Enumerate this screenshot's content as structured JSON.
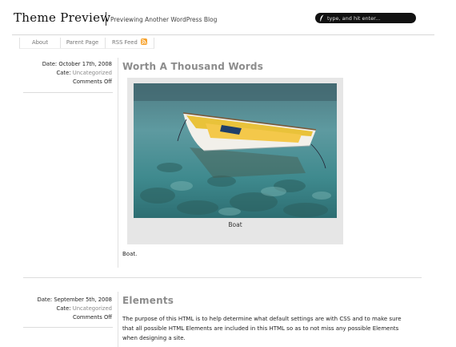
{
  "site": {
    "title": "Theme Preview",
    "tagline": "Previewing Another WordPress Blog",
    "search_placeholder": "type, and hit enter..."
  },
  "nav": {
    "items": [
      {
        "label": "About"
      },
      {
        "label": "Parent Page"
      },
      {
        "label": "RSS Feed"
      }
    ]
  },
  "posts": [
    {
      "date": "Date: October 17th, 2008",
      "cate_label": "Cate:",
      "category": "Uncategorized",
      "comments": "Comments Off",
      "title": "Worth A Thousand Words",
      "image_caption": "Boat",
      "body": "Boat."
    },
    {
      "date": "Date: September 5th, 2008",
      "cate_label": "Cate:",
      "category": "Uncategorized",
      "comments": "Comments Off",
      "title": "Elements",
      "body_lines": [
        "The purpose of this HTML is to help determine what default settings are with CSS and to make sure",
        "that all possible HTML Elements are included in this HTML so as to not miss any possible Elements",
        "when designing a site."
      ]
    }
  ],
  "colors": {
    "accent_rss": "#f7a12a",
    "title_gray": "#8c8c8c",
    "search_bg": "#111111"
  }
}
